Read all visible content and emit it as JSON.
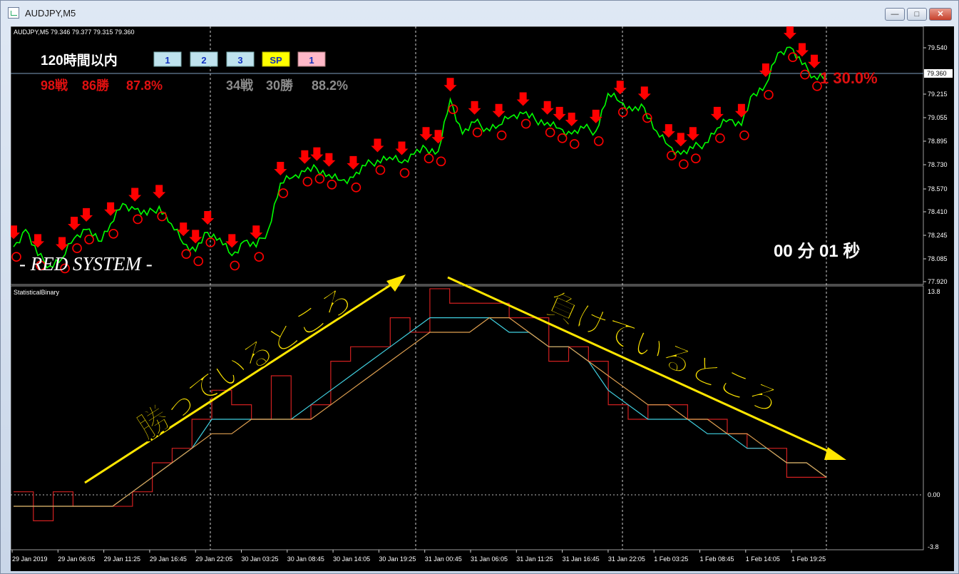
{
  "window": {
    "title": "AUDJPY,M5",
    "min_label": "—",
    "max_label": "□",
    "close_label": "✕"
  },
  "main": {
    "header": "AUDJPY,M5  79.346 79.377 79.315 79.360",
    "price_axis": [
      "79.540",
      "79.215",
      "79.055",
      "78.895",
      "78.730",
      "78.570",
      "78.410",
      "78.245",
      "78.085",
      "77.920"
    ],
    "current_price": "79.360",
    "panel": {
      "title": "120時間以内",
      "buttons": [
        "1",
        "2",
        "3",
        "SP",
        "1"
      ],
      "stats_left": [
        "98戦",
        "86勝",
        "87.8%"
      ],
      "stats_right": [
        "34戦",
        "30勝",
        "88.2%"
      ],
      "right_stat": "1  30.0%",
      "timer": "00 分 01 秒",
      "brand": "- RED SYSTEM -"
    }
  },
  "sub": {
    "name": "StatisticalBinary",
    "axis": [
      "13.8",
      "0.00",
      "-3.8"
    ],
    "label_up": "勝っているところ",
    "label_down": "負けているところ"
  },
  "time_axis": [
    "29 Jan 2019",
    "29 Jan 06:05",
    "29 Jan 11:25",
    "29 Jan 16:45",
    "29 Jan 22:05",
    "30 Jan 03:25",
    "30 Jan 08:45",
    "30 Jan 14:05",
    "30 Jan 19:25",
    "31 Jan 00:45",
    "31 Jan 06:05",
    "31 Jan 11:25",
    "31 Jan 16:45",
    "31 Jan 22:05",
    "1 Feb 03:25",
    "1 Feb 08:45",
    "1 Feb 14:05",
    "1 Feb 19:25"
  ],
  "colors": {
    "price_line": "#00ff00",
    "signal_arrow": "#ff0000",
    "step_line": "#d02020",
    "fast_ma": "#40d0e0",
    "slow_ma": "#e0a050",
    "annotation": "#ffe600"
  },
  "chart_data": [
    {
      "type": "line",
      "series": [
        {
          "values": [
            78.18,
            78.3,
            78.12,
            78.05,
            78.1,
            78.24,
            78.3,
            78.22,
            78.34,
            78.48,
            78.44,
            78.4,
            78.46,
            78.34,
            78.2,
            78.15,
            78.28,
            78.24,
            78.12,
            78.22,
            78.18,
            78.3,
            78.62,
            78.66,
            78.7,
            78.72,
            78.68,
            78.64,
            78.66,
            78.74,
            78.78,
            78.8,
            78.76,
            78.82,
            78.86,
            78.84,
            79.2,
            78.96,
            79.04,
            79.0,
            79.02,
            79.08,
            79.1,
            79.06,
            79.04,
            79.0,
            78.96,
            79.0,
            78.98,
            79.24,
            79.18,
            79.12,
            79.14,
            78.98,
            78.88,
            78.82,
            78.86,
            78.9,
            79.0,
            79.06,
            79.02,
            79.24,
            79.3,
            79.52,
            79.56,
            79.44,
            79.36,
            79.36
          ]
        }
      ],
      "ylim": [
        77.92,
        79.62
      ]
    },
    {
      "type": "line",
      "series": [
        {
          "values": [
            0,
            -2,
            0,
            -1,
            -1,
            -1,
            0,
            2,
            3,
            5,
            7,
            6,
            5,
            8,
            5,
            6,
            9,
            10,
            10,
            12,
            11,
            14,
            13,
            13,
            13,
            12,
            12,
            9,
            10,
            9,
            6,
            5,
            6,
            6,
            5,
            5,
            4,
            3,
            3,
            1,
            1,
            1
          ]
        },
        {
          "values": [
            -1,
            -1,
            -1,
            -1,
            -1,
            -1,
            0,
            1,
            2,
            3,
            5,
            5,
            5,
            5,
            5,
            6,
            7,
            8,
            9,
            10,
            11,
            12,
            12,
            12,
            12,
            11,
            11,
            10,
            10,
            9,
            7,
            6,
            5,
            5,
            5,
            4,
            4,
            3,
            3,
            2,
            2,
            1
          ]
        },
        {
          "values": [
            -1,
            -1,
            -1,
            -1,
            -1,
            -1,
            0,
            1,
            2,
            3,
            4,
            4,
            5,
            5,
            5,
            5,
            6,
            7,
            8,
            9,
            10,
            11,
            11,
            11,
            12,
            12,
            11,
            10,
            10,
            9,
            8,
            7,
            6,
            6,
            5,
            5,
            4,
            4,
            3,
            2,
            2,
            1
          ]
        }
      ],
      "ylim": [
        -3.8,
        13.8
      ]
    }
  ]
}
